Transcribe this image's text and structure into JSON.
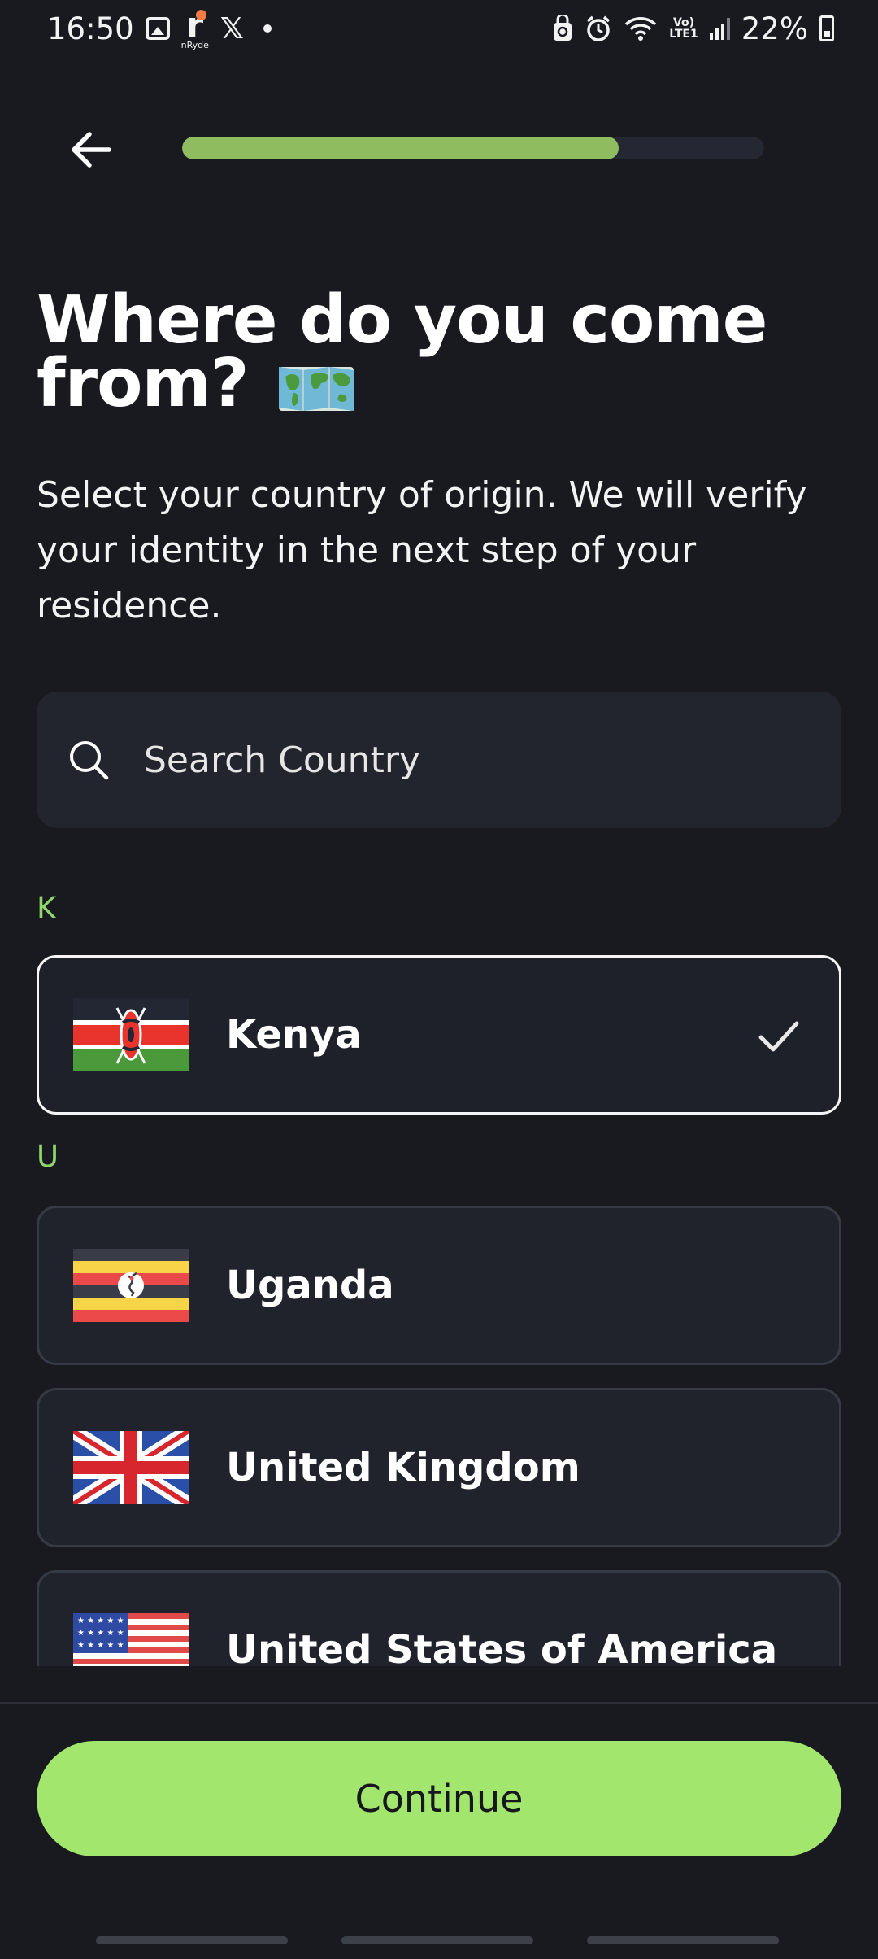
{
  "status_bar": {
    "time": "16:50",
    "left_icons": [
      "gallery-icon",
      "ryde-app-icon",
      "x-icon",
      "notification-dot"
    ],
    "ryde_small_label": "nRyde",
    "right_icons": [
      "recycle-lock-icon",
      "alarm-icon",
      "wifi-icon",
      "volte-icon",
      "signal-icon",
      "battery-icon"
    ],
    "lte_label_top": "Vo)",
    "lte_label_bottom": "LTE1",
    "battery": "22%"
  },
  "progress": {
    "fraction": 0.75
  },
  "title_line1": "Where do you come",
  "title_line2": "from?",
  "title_emoji": "world-map-icon",
  "subtitle": "Select your country of origin. We will verify your identity in the next step of your residence.",
  "search": {
    "placeholder": "Search Country",
    "value": ""
  },
  "sections": [
    {
      "letter": "K",
      "countries": [
        {
          "name": "Kenya",
          "flag": "kenya-flag-icon",
          "selected": true
        }
      ]
    },
    {
      "letter": "U",
      "countries": [
        {
          "name": "Uganda",
          "flag": "uganda-flag-icon",
          "selected": false
        },
        {
          "name": "United Kingdom",
          "flag": "uk-flag-icon",
          "selected": false
        },
        {
          "name": "United States of America",
          "flag": "usa-flag-icon",
          "selected": false
        }
      ]
    }
  ],
  "continue_label": "Continue",
  "colors": {
    "background": "#181a20",
    "accent": "#a3e66d",
    "progress": "#8fbc5e",
    "section_letter": "#8fd66a",
    "card": "#20232c"
  }
}
